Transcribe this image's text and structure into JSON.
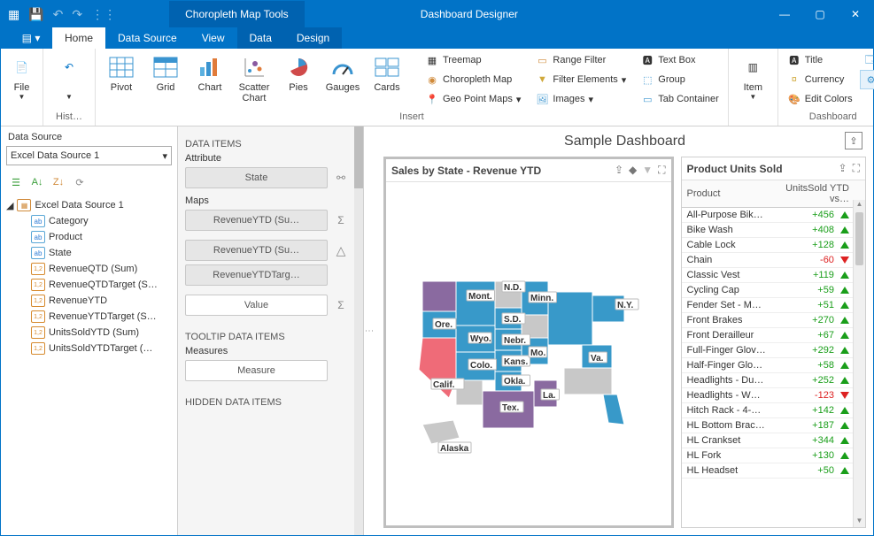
{
  "titlebar": {
    "tool_tab": "Choropleth Map Tools",
    "app_title": "Dashboard Designer"
  },
  "tabs": {
    "home": "Home",
    "data_source": "Data Source",
    "view": "View",
    "data": "Data",
    "design": "Design"
  },
  "ribbon": {
    "file": "File",
    "history_group": "Hist…",
    "pivot": "Pivot",
    "grid": "Grid",
    "chart": "Chart",
    "scatter": "Scatter\nChart",
    "pies": "Pies",
    "gauges": "Gauges",
    "cards": "Cards",
    "treemap": "Treemap",
    "choropleth": "Choropleth Map",
    "geo_point": "Geo Point Maps",
    "range_filter": "Range Filter",
    "filter_elements": "Filter Elements",
    "images": "Images",
    "text_box": "Text Box",
    "group": "Group",
    "tab_container": "Tab Container",
    "insert_group": "Insert",
    "item": "Item",
    "title": "Title",
    "currency": "Currency",
    "edit_colors": "Edit Colors",
    "dashboard_group": "Dashboard"
  },
  "left": {
    "header": "Data Source",
    "combo": "Excel Data Source 1",
    "root": "Excel Data Source 1",
    "fields": [
      "Category",
      "Product",
      "State",
      "RevenueQTD (Sum)",
      "RevenueQTDTarget (S…",
      "RevenueYTD",
      "RevenueYTDTarget (S…",
      "UnitsSoldYTD (Sum)",
      "UnitsSoldYTDTarget (…"
    ]
  },
  "mid": {
    "data_items": "DATA ITEMS",
    "attribute": "Attribute",
    "state": "State",
    "maps": "Maps",
    "rev1": "RevenueYTD (Su…",
    "rev2": "RevenueYTD (Su…",
    "rev3": "RevenueYTDTarg…",
    "value": "Value",
    "tooltip": "TOOLTIP DATA ITEMS",
    "measures": "Measures",
    "measure": "Measure",
    "hidden": "HIDDEN DATA ITEMS"
  },
  "dashboard": {
    "title": "Sample Dashboard"
  },
  "map_card": {
    "title": "Sales by State - Revenue YTD",
    "labels": [
      "Mont.",
      "N.D.",
      "Minn.",
      "Ore.",
      "Wyo.",
      "S.D.",
      "Nebr.",
      "Colo.",
      "Kans.",
      "Mo.",
      "Okla.",
      "Tex.",
      "La.",
      "Va.",
      "N.Y.",
      "Calif.",
      "Alaska"
    ]
  },
  "grid_card": {
    "title": "Product Units Sold",
    "cols": [
      "Product",
      "UnitsSold YTD vs…"
    ],
    "rows": [
      {
        "p": "All-Purpose Bik…",
        "v": "+456",
        "d": "up"
      },
      {
        "p": "Bike Wash",
        "v": "+408",
        "d": "up"
      },
      {
        "p": "Cable Lock",
        "v": "+128",
        "d": "up"
      },
      {
        "p": "Chain",
        "v": "-60",
        "d": "down"
      },
      {
        "p": "Classic Vest",
        "v": "+119",
        "d": "up"
      },
      {
        "p": "Cycling Cap",
        "v": "+59",
        "d": "up"
      },
      {
        "p": "Fender Set - M…",
        "v": "+51",
        "d": "up"
      },
      {
        "p": "Front Brakes",
        "v": "+270",
        "d": "up"
      },
      {
        "p": "Front Derailleur",
        "v": "+67",
        "d": "up"
      },
      {
        "p": "Full-Finger Glov…",
        "v": "+292",
        "d": "up"
      },
      {
        "p": "Half-Finger Glo…",
        "v": "+58",
        "d": "up"
      },
      {
        "p": "Headlights - Du…",
        "v": "+252",
        "d": "up"
      },
      {
        "p": "Headlights - W…",
        "v": "-123",
        "d": "down"
      },
      {
        "p": "Hitch Rack - 4-…",
        "v": "+142",
        "d": "up"
      },
      {
        "p": "HL Bottom Brac…",
        "v": "+187",
        "d": "up"
      },
      {
        "p": "HL Crankset",
        "v": "+344",
        "d": "up"
      },
      {
        "p": "HL Fork",
        "v": "+130",
        "d": "up"
      },
      {
        "p": "HL Headset",
        "v": "+50",
        "d": "up"
      }
    ]
  }
}
